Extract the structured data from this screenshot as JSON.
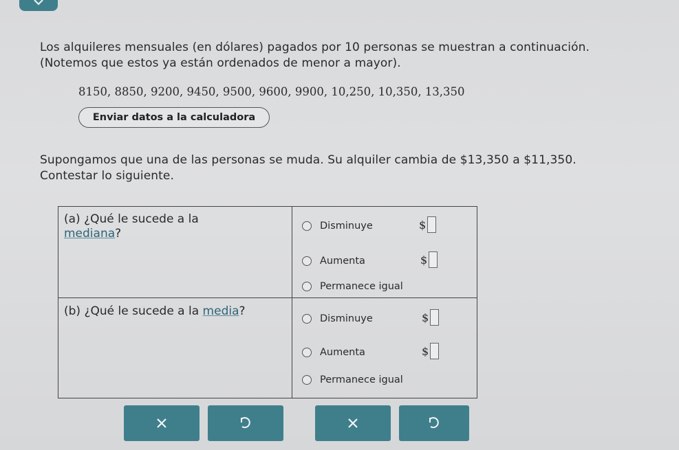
{
  "intro": {
    "line1": "Los alquileres mensuales (en dólares) pagados por 10 personas se muestran a continuación.",
    "line2": "(Notemos que estos ya están ordenados de menor a mayor)."
  },
  "data_values": "8150, 8850, 9200, 9450, 9500, 9600, 9900, 10,250, 10,350, 13,350",
  "calculator_button": "Enviar datos a la calculadora",
  "scenario": {
    "line1": "Supongamos que una de las personas se muda. Su alquiler cambia de $13,350 a $11,350.",
    "line2": "Contestar lo siguiente."
  },
  "question_a": {
    "prefix": "(a)  ¿Qué le sucede a la",
    "term": "mediana",
    "suffix": "?",
    "options": [
      "Disminuye",
      "Aumenta",
      "Permanece igual"
    ],
    "currency": "$"
  },
  "question_b": {
    "prefix": "(b)  ¿Qué le sucede a la ",
    "term": "media",
    "suffix": "?",
    "options": [
      "Disminuye",
      "Aumenta",
      "Permanece igual"
    ],
    "currency": "$"
  },
  "icons": {
    "clear": "close-icon",
    "undo": "undo-icon"
  },
  "colors": {
    "accent": "#3f7f8c",
    "link": "#2f6477"
  }
}
